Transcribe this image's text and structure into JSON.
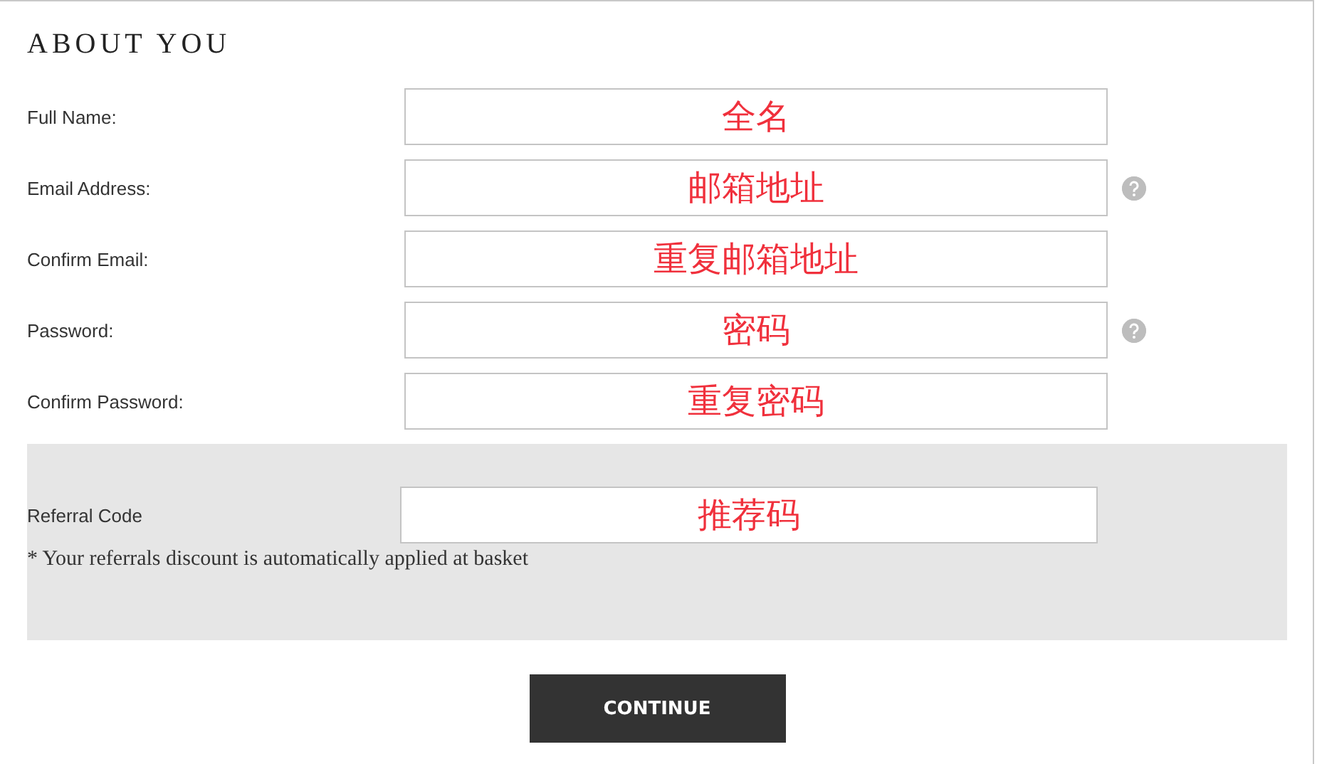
{
  "heading": "ABOUT YOU",
  "fields": [
    {
      "label": "Full Name:",
      "value": "全名",
      "help": false
    },
    {
      "label": "Email Address:",
      "value": "邮箱地址",
      "help": true
    },
    {
      "label": "Confirm Email:",
      "value": "重复邮箱地址",
      "help": false
    },
    {
      "label": "Password:",
      "value": "密码",
      "help": true
    },
    {
      "label": "Confirm Password:",
      "value": "重复密码",
      "help": false
    }
  ],
  "referral": {
    "label": "Referral Code",
    "value": "推荐码",
    "note": "* Your referrals discount is automatically applied at basket"
  },
  "continue_button": "CONTINUE"
}
